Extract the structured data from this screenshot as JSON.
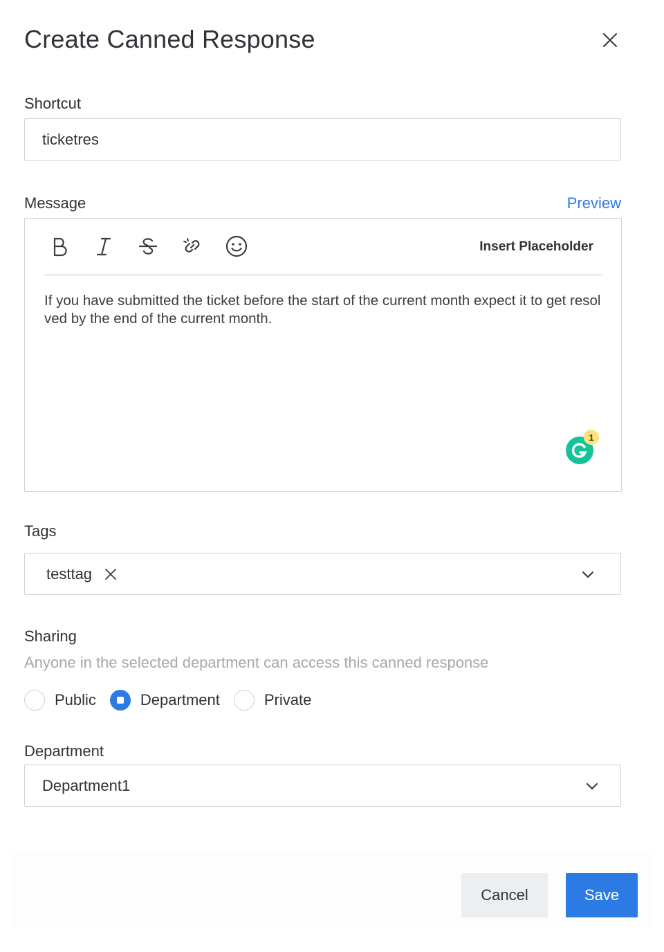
{
  "dialog": {
    "title": "Create Canned Response"
  },
  "shortcut": {
    "label": "Shortcut",
    "value": "ticketres"
  },
  "message": {
    "label": "Message",
    "preview_label": "Preview",
    "insert_placeholder_label": "Insert Placeholder",
    "toolbar_icons": [
      "bold-icon",
      "italic-icon",
      "strikethrough-icon",
      "link-icon",
      "emoji-icon"
    ],
    "body": "If you have submitted the ticket before the start of the current month expect it to get resolved by the end of the current month.",
    "grammarly_badge": "1"
  },
  "tags": {
    "label": "Tags",
    "items": [
      {
        "label": "testtag"
      }
    ]
  },
  "sharing": {
    "label": "Sharing",
    "help": "Anyone in the selected department can access this canned response",
    "options": [
      {
        "label": "Public",
        "checked": false
      },
      {
        "label": "Department",
        "checked": true
      },
      {
        "label": "Private",
        "checked": false
      }
    ]
  },
  "department": {
    "label": "Department",
    "value": "Department1"
  },
  "footer": {
    "cancel_label": "Cancel",
    "save_label": "Save"
  },
  "colors": {
    "accent": "#2c7be5",
    "grammarly": "#15c39a",
    "badge": "#fde27a"
  }
}
